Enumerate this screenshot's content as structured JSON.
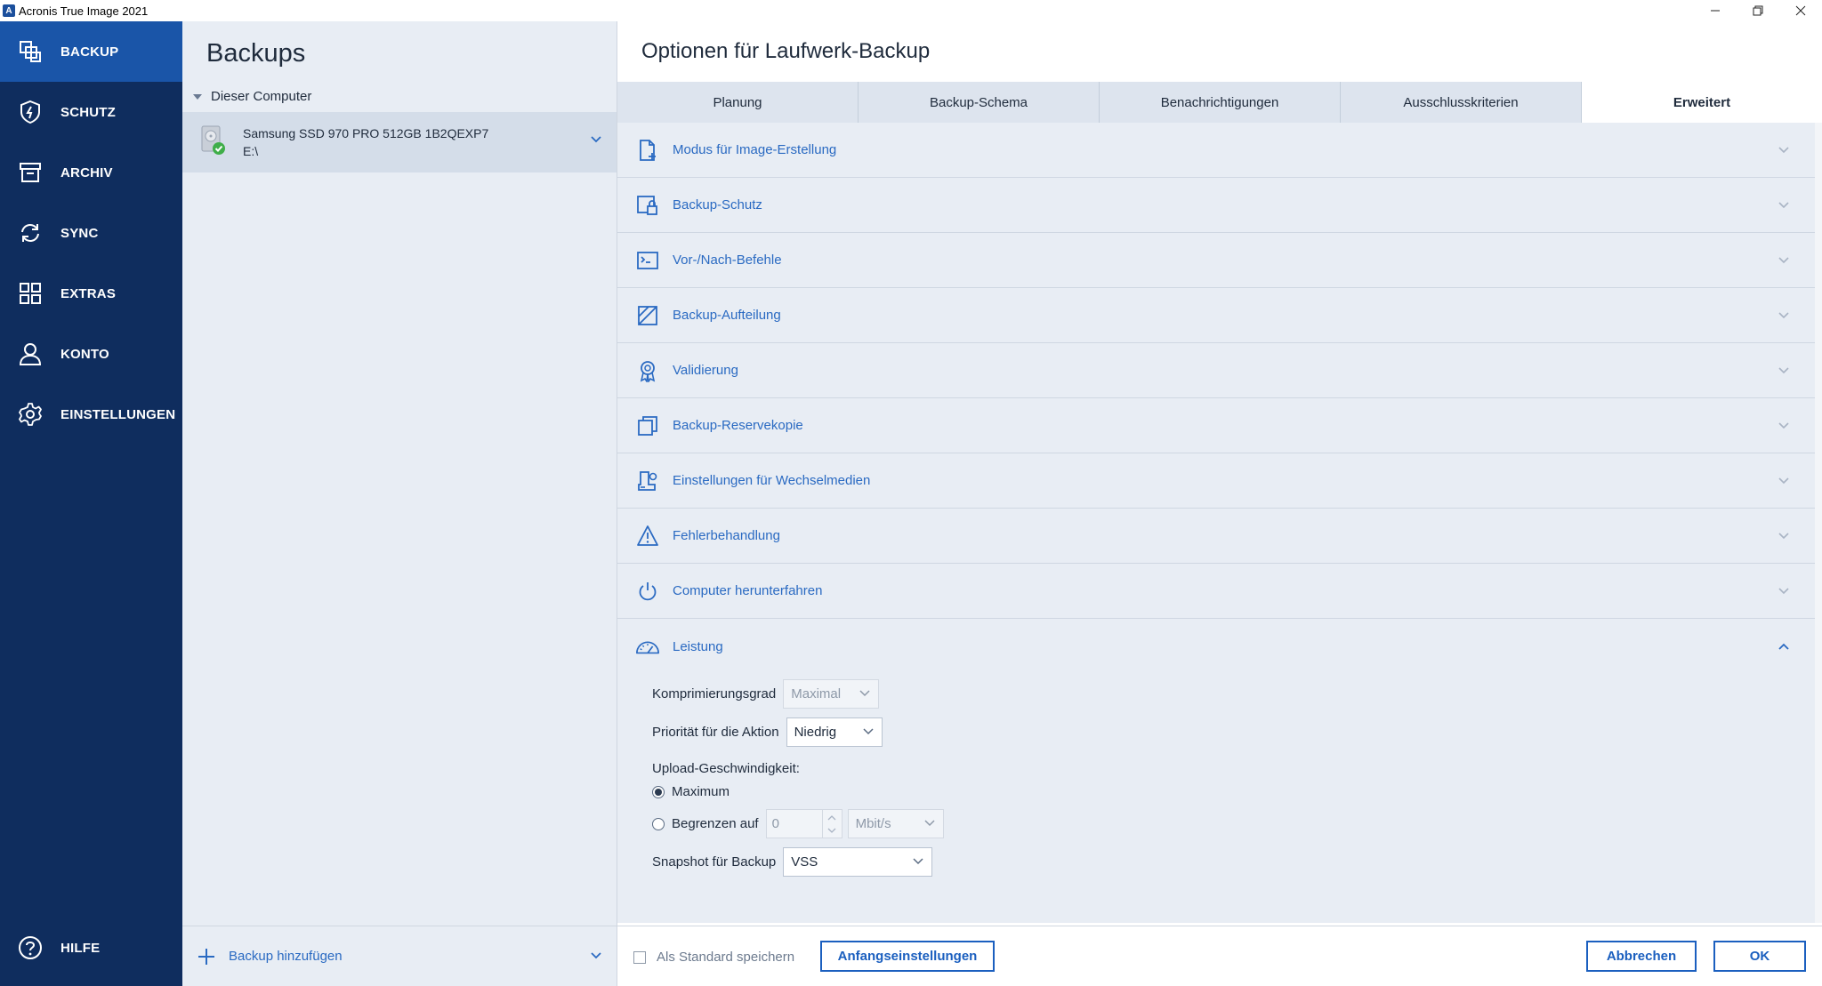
{
  "window": {
    "title": "Acronis True Image 2021",
    "controls": [
      "minimize",
      "restore",
      "close"
    ]
  },
  "nav": {
    "items": [
      {
        "label": "BACKUP",
        "icon": "backup-icon",
        "active": true
      },
      {
        "label": "SCHUTZ",
        "icon": "shield-icon",
        "active": false
      },
      {
        "label": "ARCHIV",
        "icon": "archive-icon",
        "active": false
      },
      {
        "label": "SYNC",
        "icon": "sync-icon",
        "active": false
      },
      {
        "label": "EXTRAS",
        "icon": "grid-icon",
        "active": false
      },
      {
        "label": "KONTO",
        "icon": "user-icon",
        "active": false
      },
      {
        "label": "EINSTELLUNGEN",
        "icon": "gear-icon",
        "active": false
      }
    ],
    "help_label": "HILFE"
  },
  "backups": {
    "title": "Backups",
    "group_label": "Dieser Computer",
    "item": {
      "name": "Samsung SSD 970 PRO 512GB 1B2QEXP7",
      "path": "E:\\",
      "status": "ok"
    },
    "add_label": "Backup hinzufügen"
  },
  "options": {
    "title": "Optionen für Laufwerk-Backup",
    "tabs": [
      {
        "label": "Planung",
        "active": false
      },
      {
        "label": "Backup-Schema",
        "active": false
      },
      {
        "label": "Benachrichtigungen",
        "active": false
      },
      {
        "label": "Ausschlusskriterien",
        "active": false
      },
      {
        "label": "Erweitert",
        "active": true
      }
    ],
    "sections": [
      {
        "label": "Modus für Image-Erstellung",
        "icon": "file-add-icon"
      },
      {
        "label": "Backup-Schutz",
        "icon": "lock-icon"
      },
      {
        "label": "Vor-/Nach-Befehle",
        "icon": "terminal-icon"
      },
      {
        "label": "Backup-Aufteilung",
        "icon": "split-icon"
      },
      {
        "label": "Validierung",
        "icon": "badge-icon"
      },
      {
        "label": "Backup-Reservekopie",
        "icon": "copy-icon"
      },
      {
        "label": "Einstellungen für Wechselmedien",
        "icon": "removable-media-icon"
      },
      {
        "label": "Fehlerbehandlung",
        "icon": "warning-icon"
      },
      {
        "label": "Computer herunterfahren",
        "icon": "power-icon"
      },
      {
        "label": "Leistung",
        "icon": "gauge-icon",
        "expanded": true
      }
    ],
    "performance": {
      "compression_label": "Komprimierungsgrad",
      "compression_value": "Maximal",
      "priority_label": "Priorität für die Aktion",
      "priority_value": "Niedrig",
      "upload_label": "Upload-Geschwindigkeit:",
      "radio_max": "Maximum",
      "radio_limit": "Begrenzen auf",
      "limit_value": "0",
      "limit_unit": "Mbit/s",
      "snapshot_label": "Snapshot für Backup",
      "snapshot_value": "VSS"
    },
    "footer": {
      "default_label": "Als Standard speichern",
      "reset_label": "Anfangseinstellungen",
      "cancel_label": "Abbrechen",
      "ok_label": "OK"
    }
  },
  "colors": {
    "nav_bg": "#0f2d5e",
    "nav_active": "#1a55a8",
    "link_blue": "#2a6ac2",
    "panel_bg": "#e8edf4"
  }
}
